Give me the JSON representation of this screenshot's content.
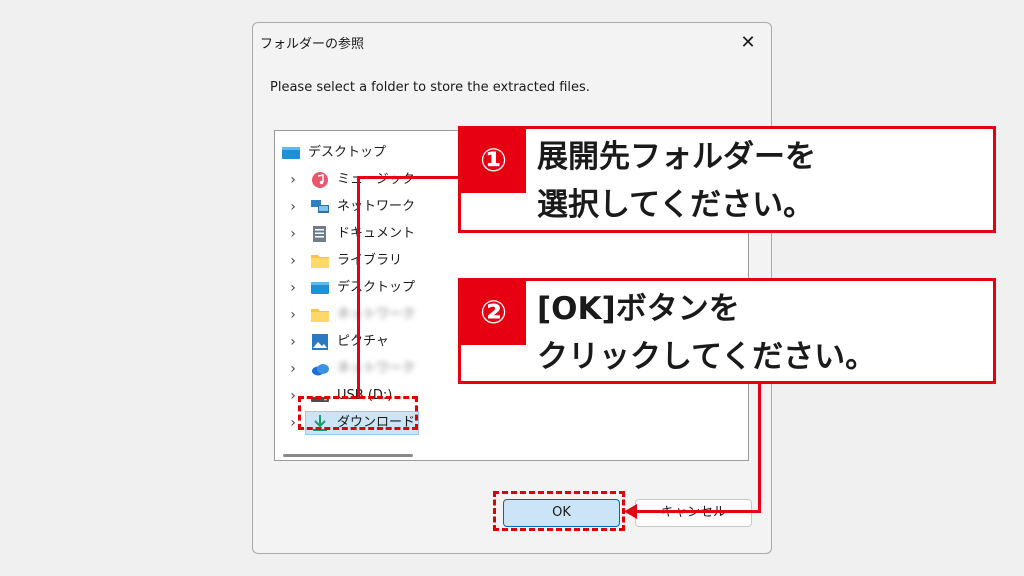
{
  "dialog": {
    "title": "フォルダーの参照",
    "close_glyph": "✕",
    "message": "Please select a folder to store the extracted files.",
    "ok_label": "OK",
    "cancel_label": "キャンセル"
  },
  "tree": {
    "items": [
      {
        "label": "デスクトップ",
        "icon": "desktop-icon"
      },
      {
        "label": "ミュージック",
        "icon": "music-icon"
      },
      {
        "label": "ネットワーク",
        "icon": "network-icon"
      },
      {
        "label": "ドキュメント",
        "icon": "document-icon"
      },
      {
        "label": "ライブラリ",
        "icon": "folder-icon"
      },
      {
        "label": "デスクトップ",
        "icon": "desktop-icon"
      },
      {
        "label": "ネットワーク",
        "icon": "folder-icon"
      },
      {
        "label": "ピクチャ",
        "icon": "pictures-icon"
      },
      {
        "label": "ネットワーク",
        "icon": "cloud-icon"
      },
      {
        "label": "USB (D:)",
        "icon": "drive-icon"
      },
      {
        "label": "ダウンロード",
        "icon": "download-icon"
      }
    ],
    "chevron": "›"
  },
  "callouts": [
    {
      "number": "①",
      "line1": "展開先フォルダーを",
      "line2": "選択してください。"
    },
    {
      "number": "②",
      "line1": "[OK]ボタンを",
      "line2": "クリックしてください。"
    }
  ],
  "colors": {
    "accent_red": "#e60012",
    "selection": "#cce4f7",
    "ok_border": "#0067c0"
  }
}
